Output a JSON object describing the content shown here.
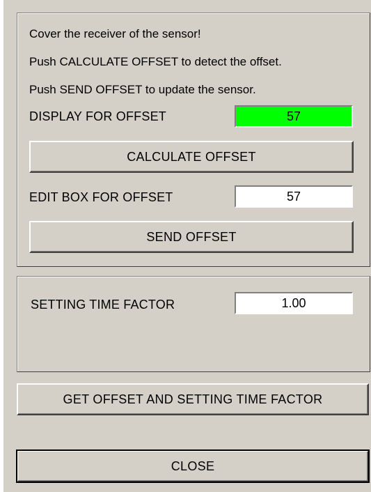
{
  "offset_panel": {
    "instructions": [
      "Cover the receiver of the sensor!",
      "Push CALCULATE OFFSET to detect the offset.",
      "Push SEND OFFSET to update the sensor."
    ],
    "display_label": "DISPLAY FOR OFFSET",
    "display_value": "57",
    "display_color": "#00ff00",
    "calculate_button": "CALCULATE OFFSET",
    "edit_label": "EDIT BOX FOR OFFSET",
    "edit_value": "57",
    "send_button": "SEND OFFSET"
  },
  "time_panel": {
    "label": "SETTING TIME FACTOR",
    "value": "1.00"
  },
  "get_button": "GET OFFSET AND SETTING TIME FACTOR",
  "close_button": "CLOSE"
}
